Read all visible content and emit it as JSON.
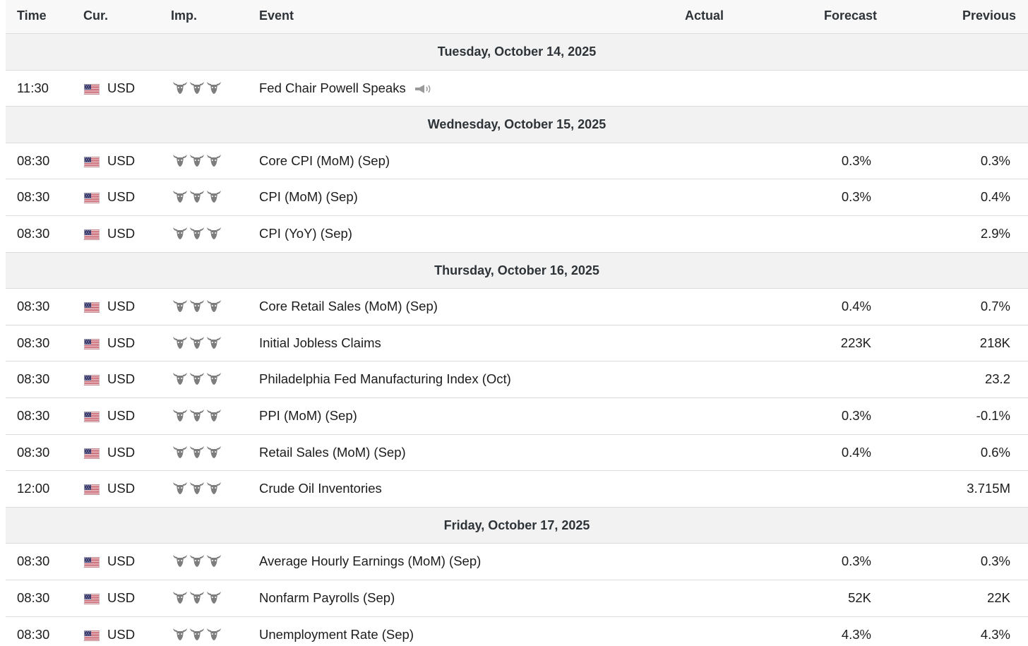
{
  "header": {
    "time": "Time",
    "currency": "Cur.",
    "importance": "Imp.",
    "event": "Event",
    "actual": "Actual",
    "forecast": "Forecast",
    "previous": "Previous"
  },
  "colors": {
    "header_bg": "#f8f8f8",
    "day_bg": "#f2f2f2",
    "border": "#dcdcdc",
    "icon_gray": "#888888"
  },
  "importance_icon": "bull-head-icon",
  "days": [
    {
      "label": "Tuesday, October 14, 2025",
      "events": [
        {
          "time": "11:30",
          "currency": "USD",
          "flag": "us-flag-icon",
          "importance": 3,
          "event": "Fed Chair Powell Speaks",
          "speech": true,
          "actual": "",
          "forecast": "",
          "previous": ""
        }
      ]
    },
    {
      "label": "Wednesday, October 15, 2025",
      "events": [
        {
          "time": "08:30",
          "currency": "USD",
          "flag": "us-flag-icon",
          "importance": 3,
          "event": "Core CPI (MoM) (Sep)",
          "actual": "",
          "forecast": "0.3%",
          "previous": "0.3%"
        },
        {
          "time": "08:30",
          "currency": "USD",
          "flag": "us-flag-icon",
          "importance": 3,
          "event": "CPI (MoM) (Sep)",
          "actual": "",
          "forecast": "0.3%",
          "previous": "0.4%"
        },
        {
          "time": "08:30",
          "currency": "USD",
          "flag": "us-flag-icon",
          "importance": 3,
          "event": "CPI (YoY) (Sep)",
          "actual": "",
          "forecast": "",
          "previous": "2.9%"
        }
      ]
    },
    {
      "label": "Thursday, October 16, 2025",
      "events": [
        {
          "time": "08:30",
          "currency": "USD",
          "flag": "us-flag-icon",
          "importance": 3,
          "event": "Core Retail Sales (MoM) (Sep)",
          "actual": "",
          "forecast": "0.4%",
          "previous": "0.7%"
        },
        {
          "time": "08:30",
          "currency": "USD",
          "flag": "us-flag-icon",
          "importance": 3,
          "event": "Initial Jobless Claims",
          "actual": "",
          "forecast": "223K",
          "previous": "218K"
        },
        {
          "time": "08:30",
          "currency": "USD",
          "flag": "us-flag-icon",
          "importance": 3,
          "event": "Philadelphia Fed Manufacturing Index (Oct)",
          "actual": "",
          "forecast": "",
          "previous": "23.2"
        },
        {
          "time": "08:30",
          "currency": "USD",
          "flag": "us-flag-icon",
          "importance": 3,
          "event": "PPI (MoM) (Sep)",
          "actual": "",
          "forecast": "0.3%",
          "previous": "-0.1%"
        },
        {
          "time": "08:30",
          "currency": "USD",
          "flag": "us-flag-icon",
          "importance": 3,
          "event": "Retail Sales (MoM) (Sep)",
          "actual": "",
          "forecast": "0.4%",
          "previous": "0.6%"
        },
        {
          "time": "12:00",
          "currency": "USD",
          "flag": "us-flag-icon",
          "importance": 3,
          "event": "Crude Oil Inventories",
          "actual": "",
          "forecast": "",
          "previous": "3.715M"
        }
      ]
    },
    {
      "label": "Friday, October 17, 2025",
      "events": [
        {
          "time": "08:30",
          "currency": "USD",
          "flag": "us-flag-icon",
          "importance": 3,
          "event": "Average Hourly Earnings (MoM) (Sep)",
          "actual": "",
          "forecast": "0.3%",
          "previous": "0.3%"
        },
        {
          "time": "08:30",
          "currency": "USD",
          "flag": "us-flag-icon",
          "importance": 3,
          "event": "Nonfarm Payrolls (Sep)",
          "actual": "",
          "forecast": "52K",
          "previous": "22K"
        },
        {
          "time": "08:30",
          "currency": "USD",
          "flag": "us-flag-icon",
          "importance": 3,
          "event": "Unemployment Rate (Sep)",
          "actual": "",
          "forecast": "4.3%",
          "previous": "4.3%"
        }
      ]
    }
  ]
}
